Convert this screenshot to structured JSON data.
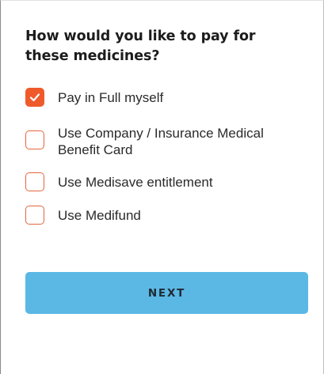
{
  "question": {
    "title": "How would you like to pay for these medicines?"
  },
  "payment_options": [
    {
      "label": "Pay in Full myself",
      "checked": true
    },
    {
      "label": "Use Company / Insurance Medical Benefit Card",
      "checked": false
    },
    {
      "label": "Use Medisave entitlement",
      "checked": false
    },
    {
      "label": "Use Medifund",
      "checked": false
    }
  ],
  "actions": {
    "next_label": "NEXT"
  },
  "colors": {
    "checkbox_accent": "#ef5a2b",
    "button_background": "#5bb8e4",
    "title_text": "#1c1c1c"
  },
  "icons": {
    "checked": "checkmark-icon"
  }
}
